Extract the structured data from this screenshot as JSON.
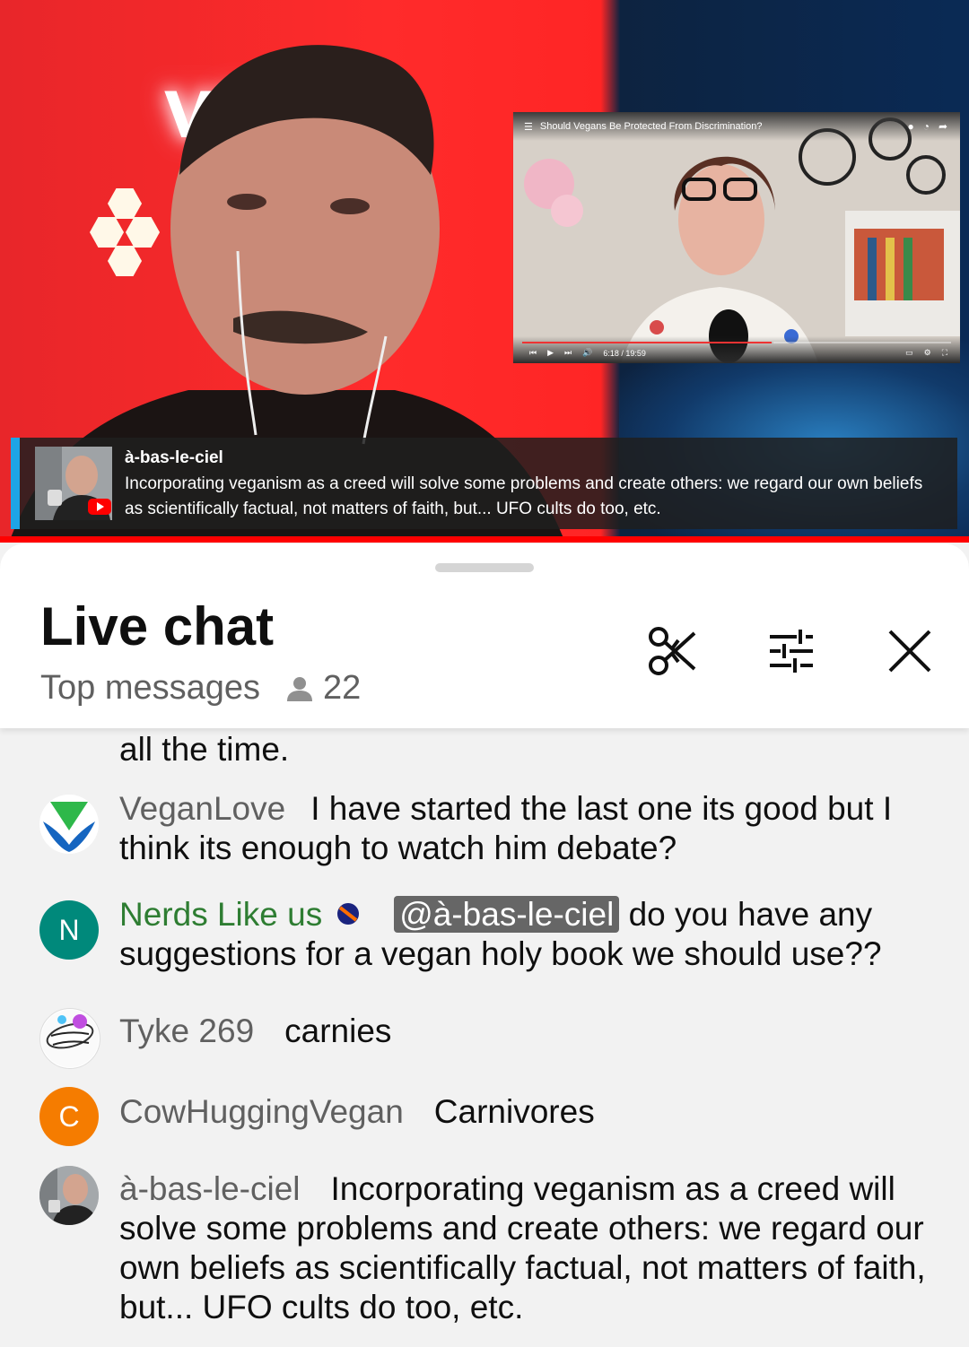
{
  "video": {
    "neon_sign": "VEGA",
    "pip": {
      "title": "Should Vegans Be Protected From Discrimination?",
      "time": "6:18 / 19:59"
    },
    "banner": {
      "author": "à-bas-le-ciel",
      "message": "Incorporating veganism as a creed will solve some problems and create others: we regard our own beliefs as scientifically factual, not matters of faith, but... UFO cults do too, etc."
    }
  },
  "chat": {
    "title": "Live chat",
    "filter": "Top messages",
    "viewer_count": "22",
    "buttons": {
      "clip": "scissors-icon",
      "settings": "sliders-icon",
      "close": "close-icon"
    },
    "continued_text": "all the time.",
    "messages": [
      {
        "author": "VeganLove",
        "text": "I have started the last one its good but I think its enough to watch him debate?",
        "avatar": "vegan-logo"
      },
      {
        "author": "Nerds Like us",
        "mention": "@à-bas-le-ciel",
        "text": " do you have any suggestions for a vegan holy book we should use??",
        "avatar_letter": "N",
        "avatar_color": "#00897b",
        "member": true
      },
      {
        "author": "Tyke 269",
        "text": "carnies",
        "avatar": "sticker"
      },
      {
        "author": "CowHuggingVegan",
        "text": "Carnivores",
        "avatar_letter": "C",
        "avatar_color": "#f57c00"
      },
      {
        "author": "à-bas-le-ciel",
        "text": "Incorporating veganism as a creed will solve some problems and create others: we regard our own beliefs as scientifically factual, not matters of faith, but... UFO cults do too, etc.",
        "avatar": "photo"
      }
    ]
  }
}
